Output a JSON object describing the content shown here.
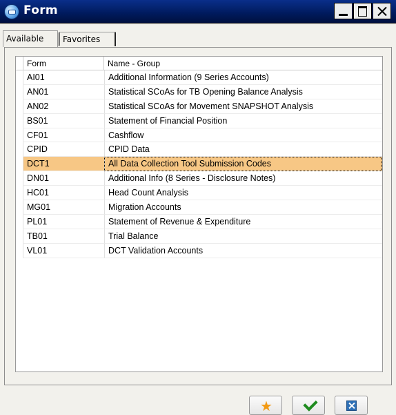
{
  "window": {
    "title": "Form"
  },
  "tabs": [
    {
      "label": "Available",
      "active": true
    },
    {
      "label": "Favorites",
      "active": false
    }
  ],
  "grid": {
    "columns": [
      "Form",
      "Name - Group"
    ],
    "selected_index": 6,
    "rows": [
      {
        "form": "AI01",
        "name": "Additional Information (9 Series Accounts)"
      },
      {
        "form": "AN01",
        "name": "Statistical SCoAs for TB Opening Balance Analysis"
      },
      {
        "form": "AN02",
        "name": "Statistical SCoAs for Movement SNAPSHOT Analysis"
      },
      {
        "form": "BS01",
        "name": "Statement of Financial Position"
      },
      {
        "form": "CF01",
        "name": "Cashflow"
      },
      {
        "form": "CPID",
        "name": "CPID Data"
      },
      {
        "form": "DCT1",
        "name": "All Data Collection Tool Submission Codes"
      },
      {
        "form": "DN01",
        "name": "Additional Info (8 Series - Disclosure Notes)"
      },
      {
        "form": "HC01",
        "name": "Head Count Analysis"
      },
      {
        "form": "MG01",
        "name": "Migration Accounts"
      },
      {
        "form": "PL01",
        "name": "Statement of Revenue & Expenditure"
      },
      {
        "form": "TB01",
        "name": "Trial Balance"
      },
      {
        "form": "VL01",
        "name": "DCT Validation Accounts"
      }
    ]
  },
  "buttons": {
    "favorite_icon": "star-icon",
    "ok_icon": "checkmark-icon",
    "cancel_icon": "close-icon"
  },
  "colors": {
    "titlebar": "#0a2f8a",
    "selected_row": "#f7c785",
    "star": "#f39a12",
    "check": "#1f8b1f",
    "cancel": "#2c6fb6"
  }
}
